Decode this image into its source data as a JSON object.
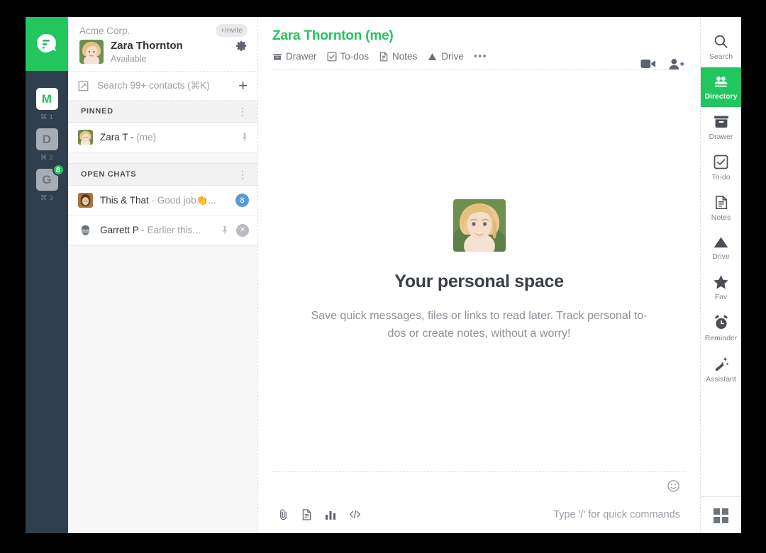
{
  "brand": {
    "green": "#22c55e",
    "rail_bg": "#303e4d",
    "badge_blue": "#5b9bd5",
    "logo_icon": "flock-logo-icon"
  },
  "rail": {
    "apps": [
      {
        "letter": "M",
        "shortcut": "⌘ 1",
        "active": true,
        "badge": ""
      },
      {
        "letter": "D",
        "shortcut": "⌘ 2",
        "active": false,
        "badge": ""
      },
      {
        "letter": "G",
        "shortcut": "⌘ 3",
        "active": false,
        "badge": "8"
      }
    ]
  },
  "sidebar": {
    "org_name": "Acme Corp.",
    "invite_label": "+Invite",
    "user_name": "Zara Thornton",
    "user_status": "Available",
    "gear_icon": "gear-icon",
    "compose_icon": "compose-icon",
    "search_placeholder": "Search 99+ contacts (⌘K)",
    "add_label": "+",
    "sections": [
      {
        "title": "PINNED",
        "rows": [
          {
            "name": "Zara  T -",
            "snippet": "",
            "me": "(me)",
            "pinned": true,
            "badge": "",
            "closable": false
          }
        ]
      },
      {
        "title": "OPEN CHATS",
        "rows": [
          {
            "name": "This & That",
            "snippet": "- Good job👏...",
            "me": "",
            "pinned": false,
            "badge": "8",
            "closable": false
          },
          {
            "name": "Garrett P",
            "snippet": "- Earlier this...",
            "me": "",
            "pinned": true,
            "badge": "",
            "closable": true
          }
        ]
      }
    ]
  },
  "main": {
    "title": "Zara Thornton (me)",
    "tabs": [
      {
        "label": "Drawer",
        "icon": "drawer-icon"
      },
      {
        "label": "To-dos",
        "icon": "checkbox-icon"
      },
      {
        "label": "Notes",
        "icon": "notes-icon"
      },
      {
        "label": "Drive",
        "icon": "drive-icon"
      }
    ],
    "more_label": "•••",
    "actions": [
      {
        "icon": "video-call-icon"
      },
      {
        "icon": "add-person-icon"
      }
    ],
    "hero_title": "Your personal space",
    "hero_subtitle": "Save quick messages, files or links to read later. Track personal to-dos or create notes, without a worry!",
    "composer": {
      "emoji_icon": "emoji-icon",
      "hint": "Type '/' for quick commands",
      "icons": [
        {
          "icon": "attachment-icon"
        },
        {
          "icon": "document-icon"
        },
        {
          "icon": "poll-icon"
        },
        {
          "icon": "code-snippet-icon"
        }
      ]
    }
  },
  "right_rail": {
    "items": [
      {
        "label": "Search",
        "icon": "search-icon",
        "active": false
      },
      {
        "label": "Directory",
        "icon": "directory-icon",
        "active": true
      },
      {
        "label": "Drawer",
        "icon": "drawer-icon",
        "active": false
      },
      {
        "label": "To-do",
        "icon": "checkbox-icon",
        "active": false
      },
      {
        "label": "Notes",
        "icon": "notes-icon",
        "active": false
      },
      {
        "label": "Drive",
        "icon": "drive-icon",
        "active": false
      },
      {
        "label": "Fav",
        "icon": "star-icon",
        "active": false
      },
      {
        "label": "Reminder",
        "icon": "alarm-icon",
        "active": false
      },
      {
        "label": "Assistant",
        "icon": "magic-wand-icon",
        "active": false
      }
    ],
    "footer_icon": "app-grid-icon"
  }
}
